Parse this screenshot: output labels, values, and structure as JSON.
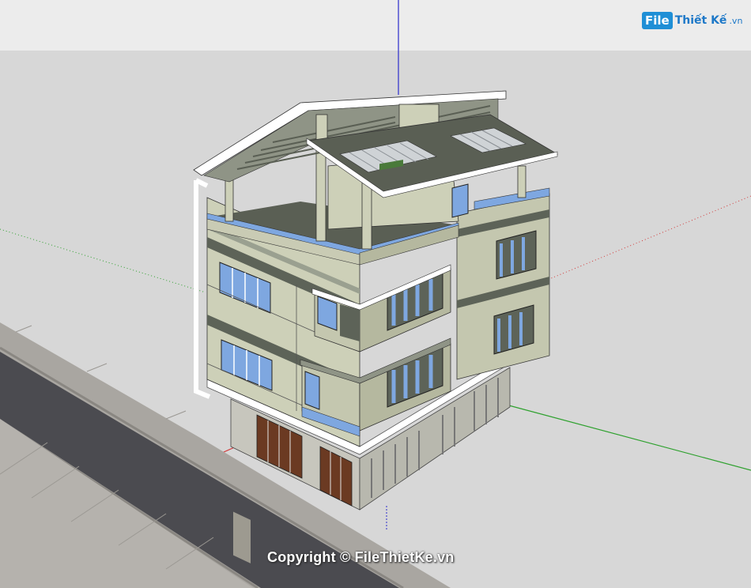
{
  "branding": {
    "logo_mark": "File",
    "logo_name": "Thiết Kế",
    "logo_tld": ".vn"
  },
  "watermark": {
    "text": "Copyright © FileThietKe.vn"
  },
  "scene": {
    "sky_color": "#ececec",
    "ground_color": "#d7d7d7",
    "axis_red": "#d23b3b",
    "axis_green": "#2fa12f",
    "axis_blue": "#2b2bcc",
    "wall_color": "#c9cbb4",
    "band_color": "#5d6358",
    "roof_color": "#5a5f54",
    "glass_color": "#7ea7e0",
    "road_color": "#4b4b50"
  }
}
